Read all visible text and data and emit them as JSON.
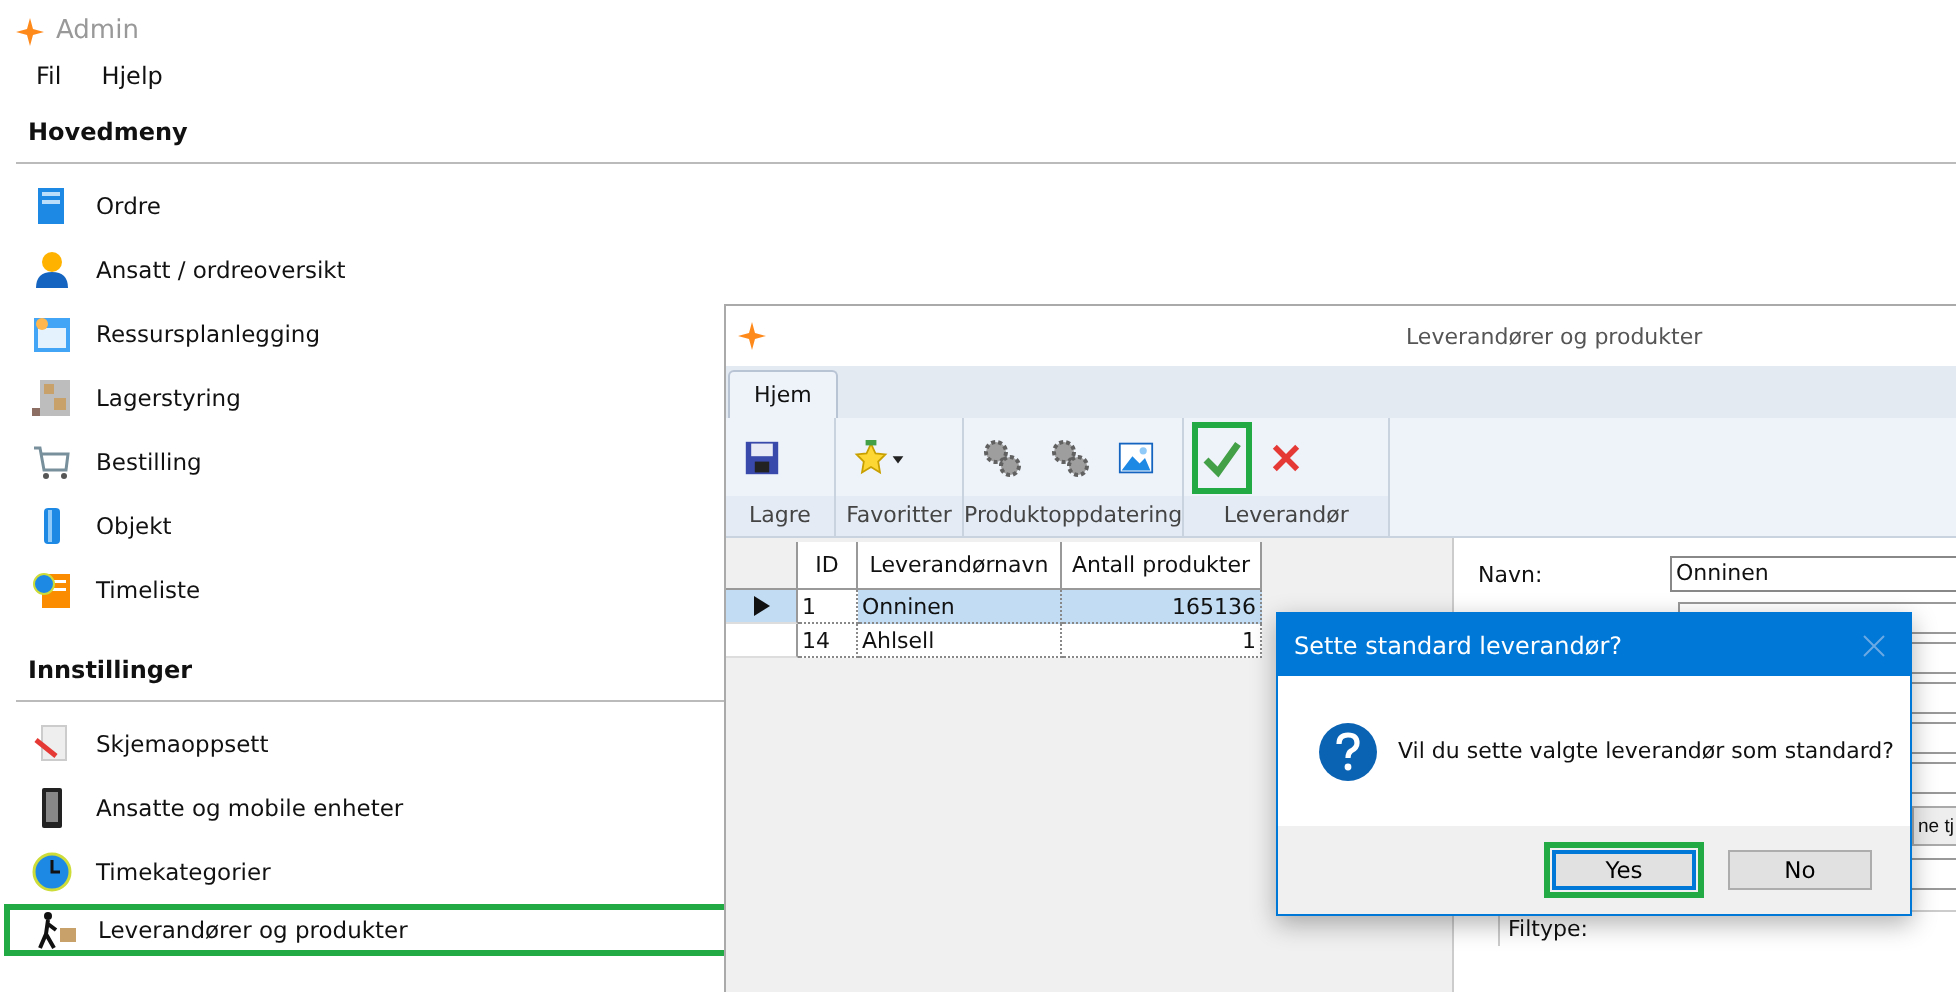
{
  "window": {
    "title": "Admin"
  },
  "menu": [
    "Fil",
    "Hjelp"
  ],
  "sections": [
    {
      "title": "Hovedmeny",
      "items": [
        {
          "label": "Ordre",
          "kind": "document",
          "highlighted": false
        },
        {
          "label": "Ansatt / ordreoversikt",
          "kind": "person",
          "highlighted": false
        },
        {
          "label": "Ressursplanlegging",
          "kind": "calendar",
          "highlighted": false
        },
        {
          "label": "Lagerstyring",
          "kind": "shelf",
          "highlighted": false
        },
        {
          "label": "Bestilling",
          "kind": "cart",
          "highlighted": false
        },
        {
          "label": "Objekt",
          "kind": "cylinder",
          "highlighted": false
        },
        {
          "label": "Timeliste",
          "kind": "timesheet",
          "highlighted": false
        }
      ]
    },
    {
      "title": "Innstillinger",
      "items": [
        {
          "label": "Skjemaoppsett",
          "kind": "form",
          "highlighted": false
        },
        {
          "label": "Ansatte og mobile enheter",
          "kind": "phone",
          "highlighted": false
        },
        {
          "label": "Timekategorier",
          "kind": "clock",
          "highlighted": false
        },
        {
          "label": "Leverandører og produkter",
          "kind": "supplier",
          "highlighted": true
        }
      ]
    }
  ],
  "child_window": {
    "title": "Leverandører og produkter",
    "tabs": [
      {
        "label": "Hjem",
        "selected": true
      }
    ],
    "ribbon_groups": [
      {
        "label": "Lagre",
        "buttons": [
          {
            "kind": "save",
            "highlighted": false
          }
        ]
      },
      {
        "label": "Favoritter",
        "buttons": [
          {
            "kind": "star",
            "highlighted": false
          }
        ]
      },
      {
        "label": "Produktoppdatering",
        "buttons": [
          {
            "kind": "gears",
            "highlighted": false
          },
          {
            "kind": "gears",
            "highlighted": false
          },
          {
            "kind": "image",
            "highlighted": false
          }
        ]
      },
      {
        "label": "Leverandør",
        "buttons": [
          {
            "kind": "check",
            "highlighted": true
          },
          {
            "kind": "cross",
            "highlighted": false
          }
        ]
      }
    ],
    "table": {
      "columns": [
        "ID",
        "Leverandørnavn",
        "Antall produkter"
      ],
      "rows": [
        {
          "cells": [
            "1",
            "Onninen",
            "165136"
          ],
          "selected": true
        },
        {
          "cells": [
            "14",
            "Ahlsell",
            "1"
          ],
          "selected": false
        }
      ]
    },
    "form": {
      "name_label": "Navn:",
      "name_value": "Onninen",
      "button_partial": "ne tj",
      "group_label": "Filtype:"
    }
  },
  "dialog": {
    "title": "Sette standard leverandør?",
    "message": "Vil du sette valgte leverandør som standard?",
    "buttons": [
      {
        "label": "Yes",
        "default": true,
        "highlighted": true
      },
      {
        "label": "No",
        "default": false,
        "highlighted": false
      }
    ]
  }
}
